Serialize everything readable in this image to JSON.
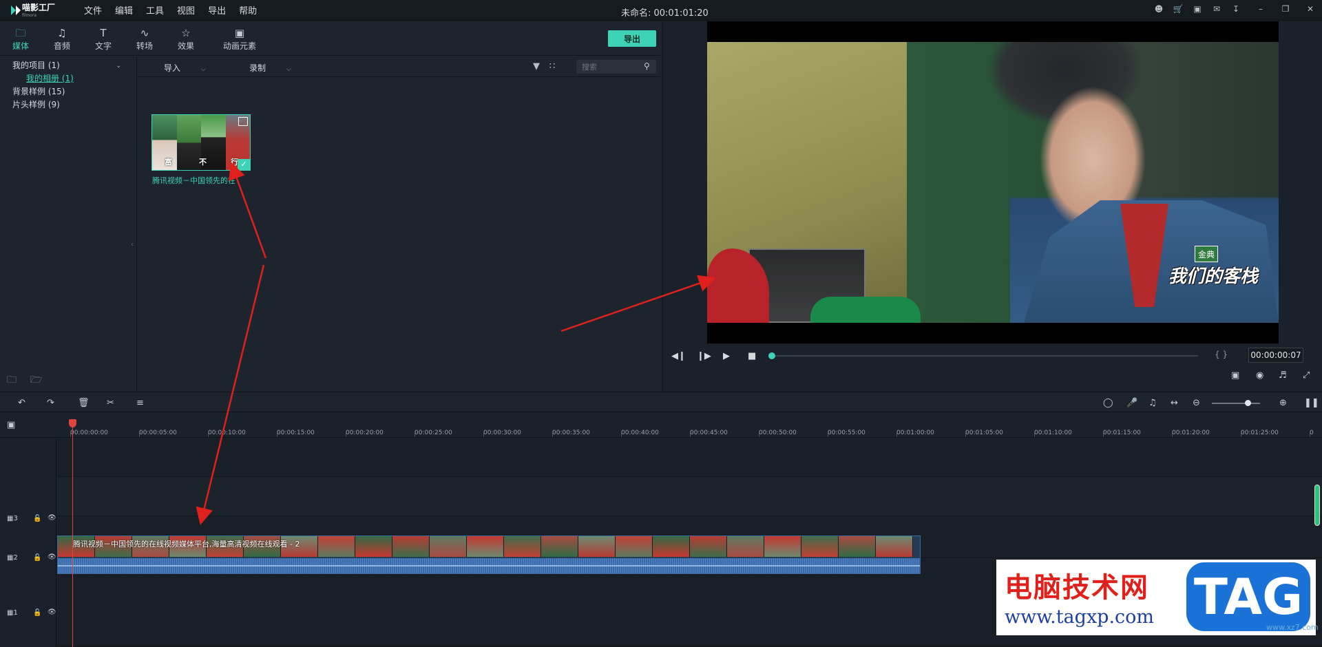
{
  "app": {
    "logo_text": "喵影工厂",
    "logo_sub": "filmora",
    "menu": [
      "文件",
      "编辑",
      "工具",
      "视图",
      "导出",
      "帮助"
    ],
    "doc_title": "未命名: 00:01:01:20"
  },
  "media": {
    "tabs": [
      {
        "label": "媒体",
        "icon": "folder-icon"
      },
      {
        "label": "音频",
        "icon": "music-note-icon"
      },
      {
        "label": "文字",
        "icon": "text-icon"
      },
      {
        "label": "转场",
        "icon": "transition-icon"
      },
      {
        "label": "效果",
        "icon": "effects-icon"
      },
      {
        "label": "动画元素",
        "icon": "image-icon"
      }
    ],
    "export_label": "导出",
    "tree": [
      {
        "label": "我的项目 (1)"
      },
      {
        "label": "我的相册 (1)"
      },
      {
        "label": "背景样例 (15)"
      },
      {
        "label": "片头样例 (9)"
      }
    ],
    "import_label": "导入",
    "record_label": "录制",
    "search_placeholder": "搜索",
    "thumb_captions": [
      "富",
      "不",
      "行"
    ],
    "thumb_label": "腾讯视频－中国领先的在"
  },
  "preview": {
    "watermark_badge": "金典",
    "watermark_logo": "我们的客栈",
    "timecode": "00:00:00:07",
    "brace": "{ }"
  },
  "timeline": {
    "ruler": [
      "00:00:00:00",
      "00:00:05:00",
      "00:00:10:00",
      "00:00:15:00",
      "00:00:20:00",
      "00:00:25:00",
      "00:00:30:00",
      "00:00:35:00",
      "00:00:40:00",
      "00:00:45:00",
      "00:00:50:00",
      "00:00:55:00",
      "00:01:00:00",
      "00:01:05:00",
      "00:01:10:00",
      "00:01:15:00",
      "00:01:20:00",
      "00:01:25:00",
      "0"
    ],
    "tracks": [
      "3",
      "2",
      "1"
    ],
    "clip_title": "腾讯视频－中国领先的在线视频媒体平台,海量高清视频在线观看 - 2"
  },
  "watermark": {
    "cn": "电脑技术网",
    "url": "www.tagxp.com",
    "tag": "TAG",
    "small": "www.xz7.com"
  },
  "colors": {
    "accent": "#3ed3b6",
    "annotation": "#e0201a",
    "playhead": "#e0453d"
  }
}
